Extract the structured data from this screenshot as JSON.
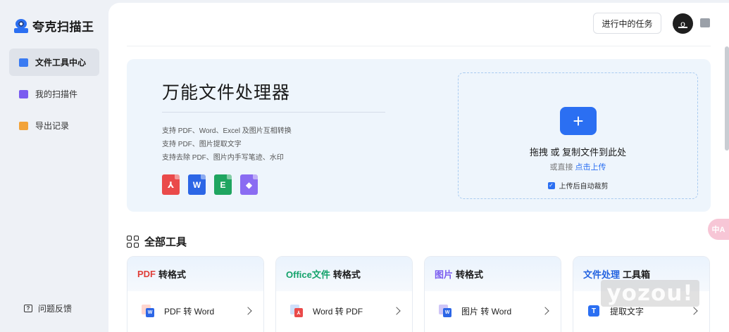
{
  "app": {
    "name": "夸克扫描王"
  },
  "sidebar": {
    "items": [
      {
        "label": "文件工具中心",
        "icon": "toolbox-icon",
        "active": true
      },
      {
        "label": "我的扫描件",
        "icon": "scan-doc-icon",
        "active": false
      },
      {
        "label": "导出记录",
        "icon": "folder-icon",
        "active": false
      }
    ],
    "feedback": {
      "label": "问题反馈",
      "icon": "feedback-icon"
    }
  },
  "header": {
    "tasks_label": "进行中的任务",
    "avatar_icon": "user-avatar-icon"
  },
  "hero": {
    "title": "万能文件处理器",
    "features": [
      "支持 PDF、Word、Excel 及图片互相转换",
      "支持 PDF、图片提取文字",
      "支持去除 PDF、图片内手写笔迹、水印"
    ],
    "file_types": [
      {
        "name": "pdf-file-icon",
        "glyph": "⅄",
        "color": "#ea4a4a"
      },
      {
        "name": "word-file-icon",
        "glyph": "W",
        "color": "#2c66e6"
      },
      {
        "name": "excel-file-icon",
        "glyph": "E",
        "color": "#1fa560"
      },
      {
        "name": "image-file-icon",
        "glyph": "◆",
        "color": "#8a6cf2"
      }
    ],
    "dropzone": {
      "plus": "+",
      "main": "拖拽 或 复制文件到此处",
      "sub_prefix": "或直接",
      "sub_link": "点击上传",
      "auto_crop_label": "上传后自动裁剪",
      "auto_crop_checked": true
    }
  },
  "tools": {
    "title": "全部工具",
    "cards": [
      {
        "keyword": "PDF",
        "suffix": "转格式",
        "row": "PDF 转 Word"
      },
      {
        "keyword": "Office文件",
        "suffix": "转格式",
        "row": "Word 转 PDF"
      },
      {
        "keyword": "图片",
        "suffix": "转格式",
        "row": "图片 转 Word"
      },
      {
        "keyword": "文件处理",
        "suffix": "工具箱",
        "row": "提取文字"
      }
    ]
  },
  "overlay": {
    "translate_label": "中A",
    "watermark": "yozou!"
  }
}
